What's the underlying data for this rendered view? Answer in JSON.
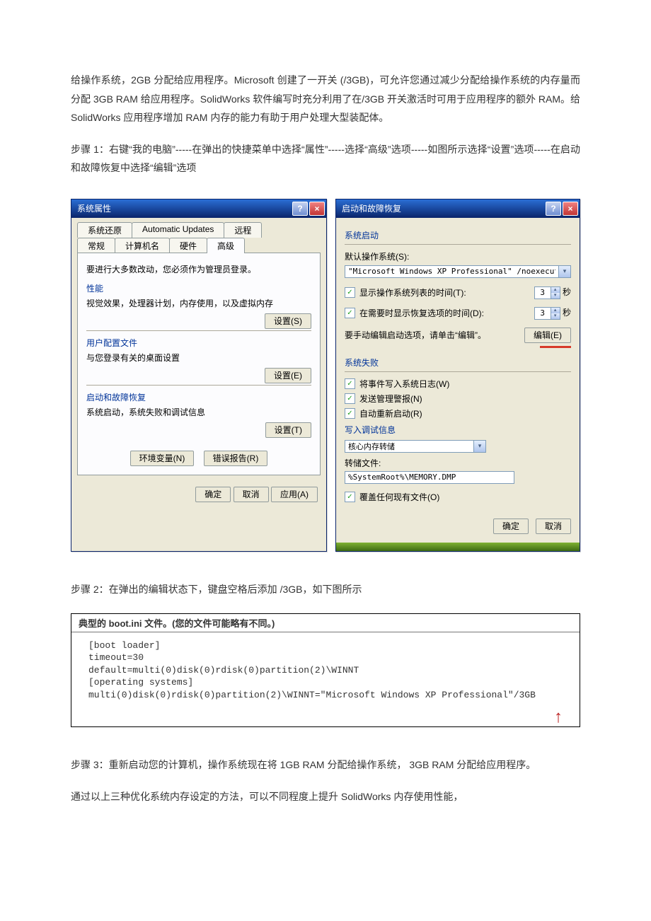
{
  "paragraphs": {
    "intro": "给操作系统，2GB 分配给应用程序。Microsoft 创建了一开关 (/3GB)，可允许您通过减少分配给操作系统的内存量而分配 3GB RAM 给应用程序。SolidWorks 软件编写时充分利用了在/3GB 开关激活时可用于应用程序的额外 RAM。给 SolidWorks 应用程序增加 RAM 内存的能力有助于用户处理大型装配体。",
    "step1": "步骤 1：右键“我的电脑”-----在弹出的快捷菜单中选择“属性”-----选择“高级”选项-----如图所示选择“设置”选项-----在启动和故障恢复中选择“编辑”选项",
    "step2": "步骤 2：在弹出的编辑状态下，键盘空格后添加  /3GB，如下图所示",
    "step3": "步骤 3：重新启动您的计算机，操作系统现在将 1GB RAM 分配给操作系统， 3GB RAM 分配给应用程序。",
    "closing": "通过以上三种优化系统内存设定的方法，可以不同程度上提升 SolidWorks 内存使用性能，"
  },
  "sysprops": {
    "title": "系统属性",
    "tabsTop": [
      "系统还原",
      "Automatic Updates",
      "远程"
    ],
    "tabsBot": [
      "常规",
      "计算机名",
      "硬件",
      "高级"
    ],
    "note": "要进行大多数改动，您必须作为管理员登录。",
    "perfTitle": "性能",
    "perfDesc": "视觉效果，处理器计划，内存使用，以及虚拟内存",
    "btnSettingsS": "设置(S)",
    "profTitle": "用户配置文件",
    "profDesc": "与您登录有关的桌面设置",
    "btnSettingsE": "设置(E)",
    "startTitle": "启动和故障恢复",
    "startDesc": "系统启动，系统失败和调试信息",
    "btnSettingsT": "设置(T)",
    "btnEnv": "环境变量(N)",
    "btnErr": "错误报告(R)",
    "btnOk": "确定",
    "btnCancel": "取消",
    "btnApply": "应用(A)"
  },
  "startup": {
    "title": "启动和故障恢复",
    "secLaunch": "系统启动",
    "defaultOsLabel": "默认操作系统(S):",
    "defaultOs": "\"Microsoft Windows XP Professional\" /noexecute=optin",
    "chkShowList": "显示操作系统列表的时间(T):",
    "chkShowRecov": "在需要时显示恢复选项的时间(D):",
    "valTime1": "3",
    "valTime2": "3",
    "secUnit": "秒",
    "editHint": "要手动编辑启动选项，请单击“编辑”。",
    "btnEdit": "编辑(E)",
    "secFail": "系统失败",
    "chkLog": "将事件写入系统日志(W)",
    "chkAlert": "发送管理警报(N)",
    "chkReboot": "自动重新启动(R)",
    "writeDbg": "写入调试信息",
    "dumpType": "核心内存转储",
    "dumpFileLabel": "转储文件:",
    "dumpFile": "%SystemRoot%\\MEMORY.DMP",
    "chkOverwrite": "覆盖任何现有文件(O)",
    "btnOk": "确定",
    "btnCancel": "取消"
  },
  "boot": {
    "header": "典型的 boot.ini 文件。(您的文件可能略有不同。)",
    "line1": "[boot loader]",
    "line2": "timeout=30",
    "line3": "default=multi(0)disk(0)rdisk(0)partition(2)\\WINNT",
    "line4": "[operating systems]",
    "line5": "multi(0)disk(0)rdisk(0)partition(2)\\WINNT=\"Microsoft Windows XP Professional\"/3GB"
  }
}
